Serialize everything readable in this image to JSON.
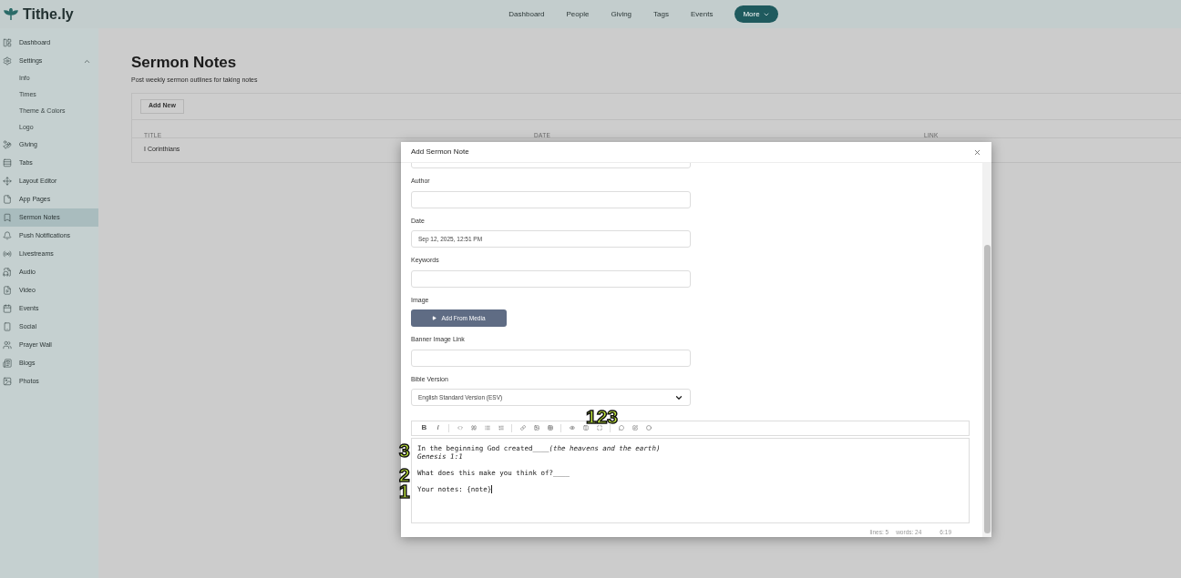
{
  "brand": {
    "name": "Tithe.ly"
  },
  "top_nav": [
    {
      "label": "Dashboard",
      "kind": "link"
    },
    {
      "label": "People",
      "kind": "link"
    },
    {
      "label": "Giving",
      "kind": "link"
    },
    {
      "label": "Tags",
      "kind": "link"
    },
    {
      "label": "Events",
      "kind": "link"
    },
    {
      "label": "More",
      "kind": "menu"
    }
  ],
  "sidebar": {
    "items": [
      {
        "label": "Dashboard",
        "selected": false
      },
      {
        "label": "Settings",
        "selected": false,
        "expanded": true,
        "children": [
          {
            "label": "Info"
          },
          {
            "label": "Times"
          },
          {
            "label": "Theme & Colors"
          },
          {
            "label": "Logo"
          }
        ]
      },
      {
        "label": "Giving",
        "selected": false
      },
      {
        "label": "Tabs",
        "selected": false
      },
      {
        "label": "Layout Editor",
        "selected": false
      },
      {
        "label": "App Pages",
        "selected": false
      },
      {
        "label": "Sermon Notes",
        "selected": true
      },
      {
        "label": "Push Notifications",
        "selected": false
      },
      {
        "label": "Livestreams",
        "selected": false
      },
      {
        "label": "Audio",
        "selected": false
      },
      {
        "label": "Video",
        "selected": false
      },
      {
        "label": "Events",
        "selected": false
      },
      {
        "label": "Social",
        "selected": false
      },
      {
        "label": "Prayer Wall",
        "selected": false
      },
      {
        "label": "Blogs",
        "selected": false
      },
      {
        "label": "Photos",
        "selected": false
      }
    ]
  },
  "page": {
    "title": "Sermon Notes",
    "subtitle": "Post weekly sermon outlines for taking notes",
    "add_button": "Add New",
    "table": {
      "columns": [
        "TITLE",
        "DATE",
        "LINK"
      ],
      "rows": [
        [
          "I Corinthians"
        ]
      ]
    }
  },
  "modal": {
    "title": "Add Sermon Note",
    "fields": [
      {
        "kind": "input"
      },
      {
        "kind": "input",
        "label": "Author"
      },
      {
        "kind": "input",
        "label": "Date",
        "value": "Sep 12, 2025, 12:51 PM"
      },
      {
        "kind": "input",
        "label": "Keywords"
      },
      {
        "kind": "media",
        "label": "Image",
        "button": "Add From Media"
      },
      {
        "kind": "input",
        "label": "Banner Image Link"
      },
      {
        "kind": "select",
        "label": "Bible Version",
        "value": "English Standard Version (ESV)"
      }
    ],
    "editor": {
      "toolbar": [
        {
          "kind": "text",
          "label": "B"
        },
        {
          "kind": "text",
          "label": "I"
        },
        {
          "kind": "sep"
        },
        {
          "kind": "icon"
        },
        {
          "kind": "icon"
        },
        {
          "kind": "icon"
        },
        {
          "kind": "icon"
        },
        {
          "kind": "sep"
        },
        {
          "kind": "icon"
        },
        {
          "kind": "icon"
        },
        {
          "kind": "icon"
        },
        {
          "kind": "sep"
        },
        {
          "kind": "icon"
        },
        {
          "kind": "icon"
        },
        {
          "kind": "icon"
        },
        {
          "kind": "sep"
        },
        {
          "kind": "icon"
        },
        {
          "kind": "icon"
        },
        {
          "kind": "icon"
        }
      ],
      "lines": [
        {
          "kind": "text",
          "badge": "3",
          "parts": [
            {
              "text": "In the beginning God created____",
              "italic": false
            },
            {
              "text": "(the heavens and the earth)",
              "italic": true
            }
          ]
        },
        {
          "kind": "text",
          "parts": [
            {
              "text": "Genesis 1:1",
              "italic": true
            }
          ]
        },
        {
          "kind": "blank"
        },
        {
          "kind": "text",
          "badge": "2",
          "parts": [
            {
              "text": "What does this make you think of?____",
              "italic": false
            }
          ]
        },
        {
          "kind": "blank"
        },
        {
          "kind": "text",
          "badge": "1",
          "cursor": true,
          "parts": [
            {
              "text": "Your notes: {note}",
              "italic": false
            }
          ]
        }
      ],
      "toolbar_badge": "123",
      "status": [
        "lines: 5",
        "words: 24",
        "6:19"
      ]
    }
  }
}
